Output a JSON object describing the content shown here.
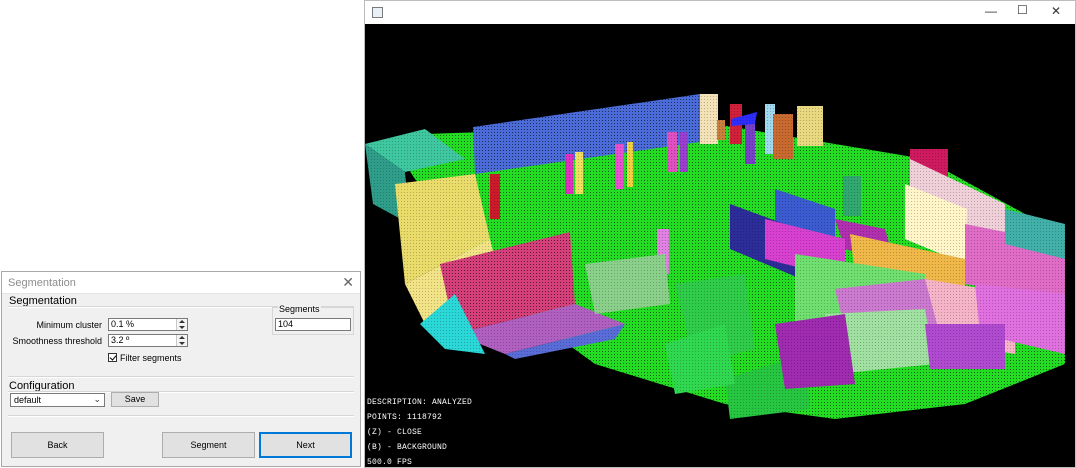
{
  "dialog": {
    "title": "Segmentation",
    "group_label": "Segmentation",
    "min_cluster_label": "Minimum cluster",
    "min_cluster_value": "0.1 %",
    "smoothness_label": "Smoothness threshold",
    "smoothness_value": "3.2 º",
    "filter_label": "Filter segments",
    "filter_checked": true,
    "segments_label": "Segments",
    "segments_value": "104",
    "config_label": "Configuration",
    "config_selected": "default",
    "save_label": "Save",
    "back_label": "Back",
    "segment_label": "Segment",
    "next_label": "Next"
  },
  "viewer": {
    "hud": [
      "DESCRIPTION: ANALYZED",
      "POINTS: 1118792",
      "(Z) - CLOSE",
      "(B) - BACKGROUND",
      "500.0 FPS"
    ],
    "controls": {
      "minimize": "—",
      "maximize": "☐",
      "close": "✕"
    }
  },
  "colors": {
    "floor": "#22dd22",
    "wall_blue": "#4a6bd8",
    "wall_pink": "#dd2ad0",
    "wall_magenta": "#e050c0",
    "wall_cyan": "#2ad8d8",
    "wall_yellow": "#f0d040",
    "wall_light_green": "#70e070",
    "background": "#000000"
  }
}
